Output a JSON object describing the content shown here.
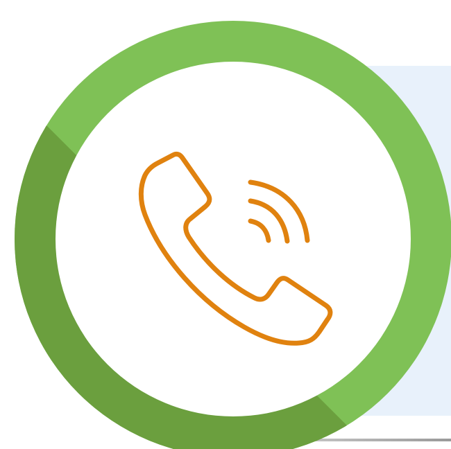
{
  "icon": {
    "name": "phone-ringing-icon",
    "stroke_color": "#e0820f"
  },
  "ring": {
    "light_color": "#7fc156",
    "dark_color": "#6b9f3e",
    "inner_color": "#ffffff"
  },
  "backdrop": {
    "color": "#e8f1fb"
  }
}
